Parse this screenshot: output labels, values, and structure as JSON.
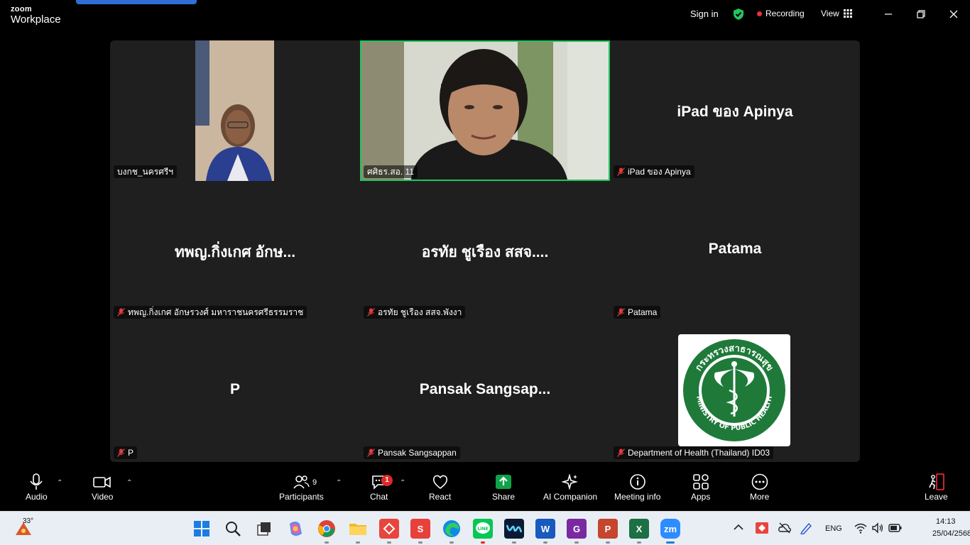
{
  "topbar": {
    "brand_line1": "zoom",
    "brand_line2": "Workplace",
    "sign_in": "Sign in",
    "recording": "Recording",
    "view": "View"
  },
  "tiles": [
    {
      "label": "บงกช_นครศรีฯ",
      "center_name": "",
      "muted": false
    },
    {
      "label": "ศศิธร.สอ. 11",
      "center_name": "",
      "muted": false
    },
    {
      "label": "iPad ของ Apinya",
      "center_name": "iPad ของ Apinya",
      "muted": true
    },
    {
      "label": "ทพญ.กิ่งเกศ อักษรวงศ์ มหาราชนครศรีธรรมราช",
      "center_name": "ทพญ.กิ่งเกศ อักษ...",
      "muted": true
    },
    {
      "label": "อรทัย ชูเรือง สสจ.พังงา",
      "center_name": "อรทัย ชูเรือง สสจ....",
      "muted": true
    },
    {
      "label": "Patama",
      "center_name": "Patama",
      "muted": true
    },
    {
      "label": "P",
      "center_name": "P",
      "muted": true
    },
    {
      "label": "Pansak Sangsappan",
      "center_name": "Pansak  Sangsap...",
      "muted": true
    },
    {
      "label": "Department of Health (Thailand) ID03",
      "center_name": "",
      "muted": true
    }
  ],
  "logo": {
    "text_top": "กระทรวงสาธารณสุข",
    "text_bottom": "MINISTRY OF PUBLIC HEALTH",
    "color": "#1f7a3a"
  },
  "controls": {
    "audio": "Audio",
    "video": "Video",
    "participants": "Participants",
    "participants_count": "9",
    "chat": "Chat",
    "chat_badge": "1",
    "react": "React",
    "share": "Share",
    "ai_companion": "AI Companion",
    "meeting_info": "Meeting info",
    "apps": "Apps",
    "more": "More",
    "leave": "Leave"
  },
  "taskbar": {
    "weather_temp": "33°",
    "language": "ENG",
    "time": "14:13",
    "date": "25/04/2568",
    "apps": [
      "start-icon",
      "search-icon",
      "task-view-icon",
      "copilot-icon",
      "chrome-icon",
      "file-explorer-icon",
      "anydesk-icon",
      "wps-icon",
      "edge-icon",
      "line-icon",
      "webex-icon",
      "word-icon",
      "pdf-icon",
      "powerpoint-icon",
      "excel-icon",
      "zoom-icon"
    ]
  },
  "colors": {
    "accent_green": "#22c55e",
    "recording_red": "#e8323c",
    "share_green": "#0ea34a"
  }
}
